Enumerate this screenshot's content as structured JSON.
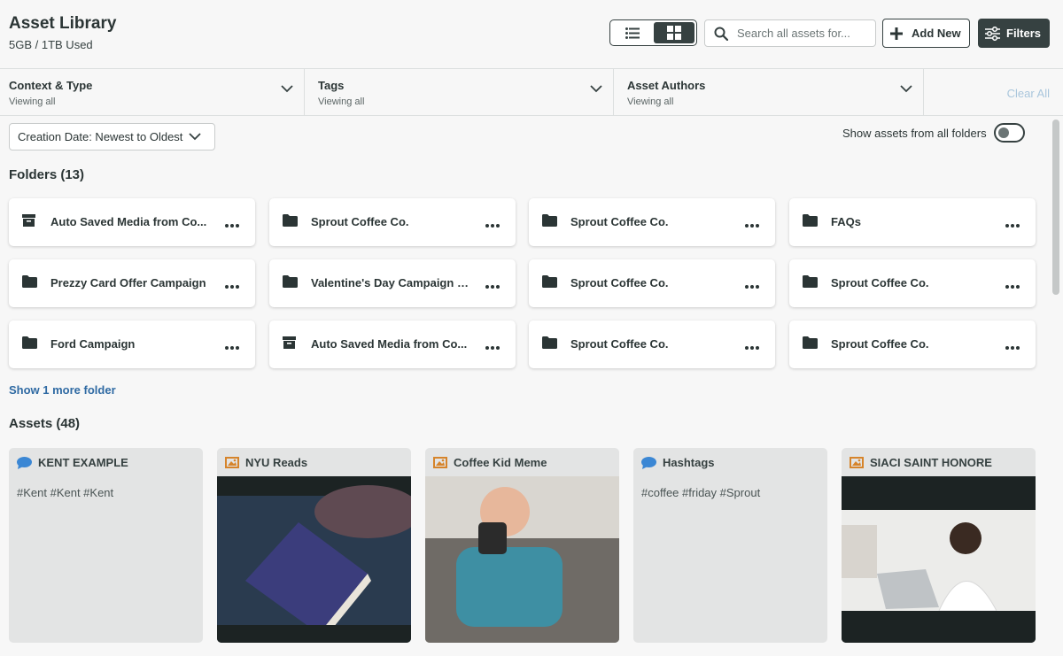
{
  "header": {
    "title": "Asset Library",
    "usage": "5GB / 1TB Used",
    "search_placeholder": "Search all assets for...",
    "add_new_label": "Add New",
    "filters_label": "Filters"
  },
  "filter_bar": {
    "segments": [
      {
        "label": "Context & Type",
        "sub": "Viewing all"
      },
      {
        "label": "Tags",
        "sub": "Viewing all"
      },
      {
        "label": "Asset Authors",
        "sub": "Viewing all"
      }
    ],
    "clear_all": "Clear All"
  },
  "sort": {
    "value": "Creation Date: Newest to Oldest"
  },
  "show_all_folders": {
    "label": "Show assets from all folders",
    "on": false
  },
  "folders": {
    "heading": "Folders (13)",
    "items": [
      {
        "name": "Auto Saved Media from Co...",
        "icon": "archive-icon"
      },
      {
        "name": "Sprout Coffee Co.",
        "icon": "folder-icon"
      },
      {
        "name": "Sprout Coffee Co.",
        "icon": "folder-icon"
      },
      {
        "name": "FAQs",
        "icon": "folder-icon"
      },
      {
        "name": "Prezzy Card Offer Campaign",
        "icon": "folder-icon"
      },
      {
        "name": "Valentine's Day Campaign (...",
        "icon": "folder-icon"
      },
      {
        "name": "Sprout Coffee Co.",
        "icon": "folder-icon"
      },
      {
        "name": "Sprout Coffee Co.",
        "icon": "folder-icon"
      },
      {
        "name": "Ford Campaign",
        "icon": "folder-icon"
      },
      {
        "name": "Auto Saved Media from Co...",
        "icon": "archive-icon"
      },
      {
        "name": "Sprout Coffee Co.",
        "icon": "folder-icon"
      },
      {
        "name": "Sprout Coffee Co.",
        "icon": "folder-icon"
      }
    ],
    "show_more": "Show 1 more folder"
  },
  "assets": {
    "heading": "Assets (48)",
    "items": [
      {
        "name": "KENT EXAMPLE",
        "type": "text",
        "icon": "speech-bubble-icon",
        "text": "#Kent #Kent #Kent"
      },
      {
        "name": "NYU Reads",
        "type": "image",
        "icon": "image-icon",
        "text": ""
      },
      {
        "name": "Coffee Kid Meme",
        "type": "image",
        "icon": "image-icon",
        "text": ""
      },
      {
        "name": "Hashtags",
        "type": "text",
        "icon": "speech-bubble-icon",
        "text": "#coffee #friday #Sprout"
      },
      {
        "name": "SIACI SAINT HONORE",
        "type": "image",
        "icon": "image-icon",
        "text": ""
      }
    ]
  },
  "colors": {
    "primary_dark": "#364141",
    "link_blue": "#2f6aa3",
    "image_icon_orange": "#d6842b",
    "text_icon_blue": "#3b87d4"
  }
}
